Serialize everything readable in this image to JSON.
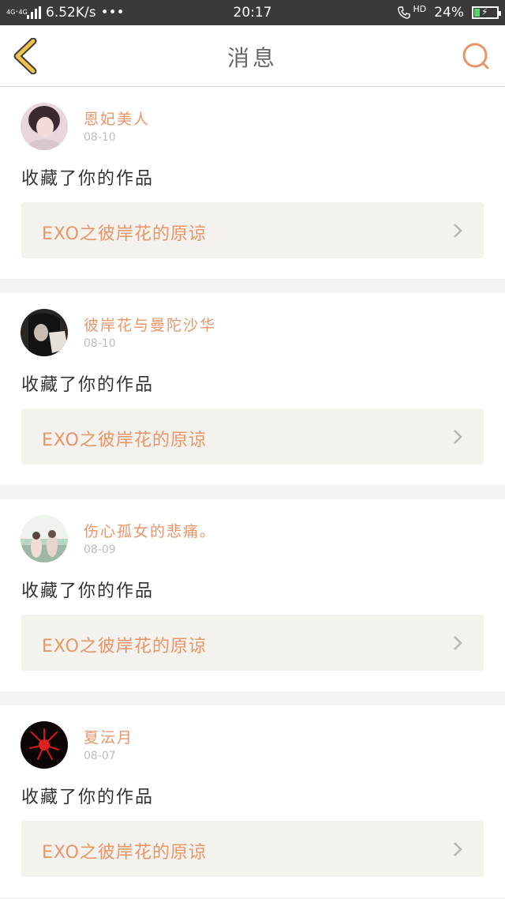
{
  "status_bar": {
    "network": "4G⁺4G",
    "speed": "6.52K/s",
    "dots": "•••",
    "time": "20:17",
    "hd": "HD",
    "battery": "24%",
    "battery_level": 0.24
  },
  "header": {
    "title": "消息",
    "back_icon": "chevron-left-icon",
    "search_icon": "search-icon"
  },
  "colors": {
    "accent": "#e8956a",
    "back": "#f0c24a",
    "card_bg": "#ffffff",
    "work_bg": "#f3f2ec"
  },
  "messages": [
    {
      "name": "恩妃美人",
      "date": "08-10",
      "action": "收藏了你的作品",
      "work": "EXO之彼岸花的原谅"
    },
    {
      "name": "彼岸花与曼陀沙华",
      "date": "08-10",
      "action": "收藏了你的作品",
      "work": "EXO之彼岸花的原谅"
    },
    {
      "name": "伤心孤女的悲痛。",
      "date": "08-09",
      "action": "收藏了你的作品",
      "work": "EXO之彼岸花的原谅"
    },
    {
      "name": "夏沄月",
      "date": "08-07",
      "action": "收藏了你的作品",
      "work": "EXO之彼岸花的原谅"
    }
  ]
}
